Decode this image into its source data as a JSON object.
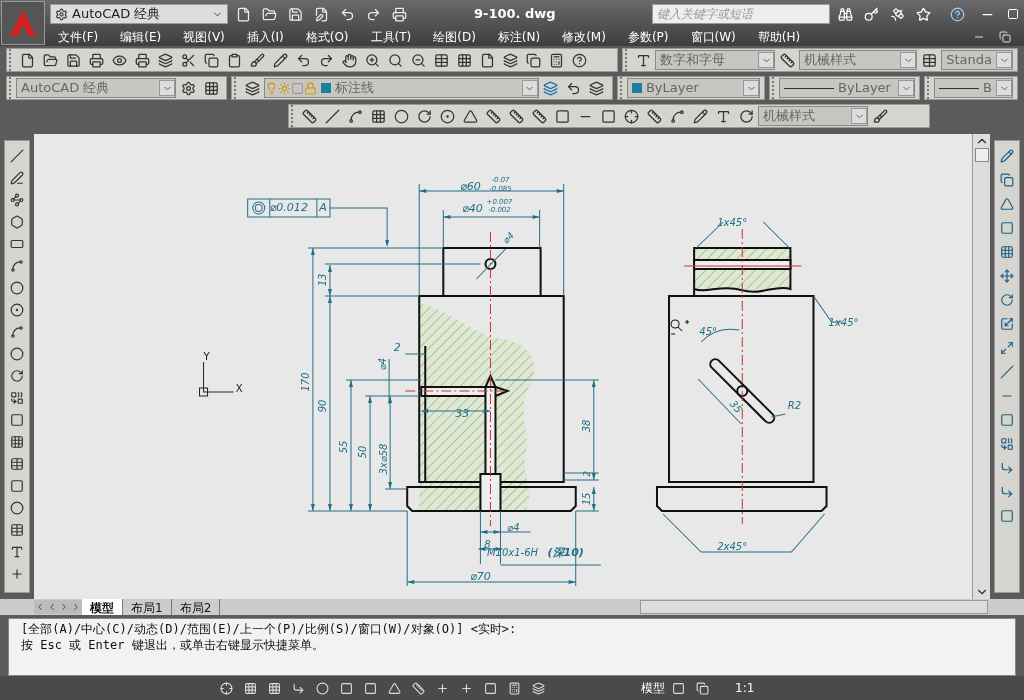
{
  "title_bar": {
    "workspace": "AutoCAD 经典",
    "filename": "9-100. dwg",
    "search_placeholder": "键入关键字或短语"
  },
  "menu": [
    "文件(F)",
    "编辑(E)",
    "视图(V)",
    "插入(I)",
    "格式(O)",
    "工具(T)",
    "绘图(D)",
    "标注(N)",
    "修改(M)",
    "参数(P)",
    "窗口(W)",
    "帮助(H)"
  ],
  "toolbars": {
    "text_style": "数字和字母",
    "dim_style": "机械样式",
    "table_style": "Standa",
    "workspace": "AutoCAD 经典",
    "layer": "标注线",
    "color_combo": "ByLayer",
    "linetype": "ByLayer",
    "lineweight": "B",
    "dim_style_2": "机械样式"
  },
  "drawing": {
    "axis_labels": [
      "Y",
      "X"
    ],
    "labels": [
      "⌀0.012",
      "A",
      "⌀60",
      "-0.07",
      "-0.085",
      "⌀40",
      "+0.007",
      "-0.002",
      "⌀4",
      "13",
      "170",
      "90",
      "55",
      "50",
      "3x⌀58",
      "⌀4",
      "2",
      "33",
      "38",
      "2",
      "15",
      "⌀4",
      "8",
      "M10x1-6H",
      "(深10)",
      "⌀70",
      "1x45°",
      "1x45°",
      "45°",
      "35",
      "R2",
      "2x45°"
    ]
  },
  "layout_tabs": [
    {
      "label": "模型",
      "selected": true
    },
    {
      "label": "布局1",
      "selected": false
    },
    {
      "label": "布局2",
      "selected": false
    }
  ],
  "command_lines": [
    "[全部(A)/中心(C)/动态(D)/范围(E)/上一个(P)/比例(S)/窗口(W)/对象(O)] <实时>:",
    "按 Esc 或 Enter 键退出，或单击右键显示快捷菜单。"
  ],
  "status_bar": {
    "space": "模型",
    "scale": "1:1"
  }
}
